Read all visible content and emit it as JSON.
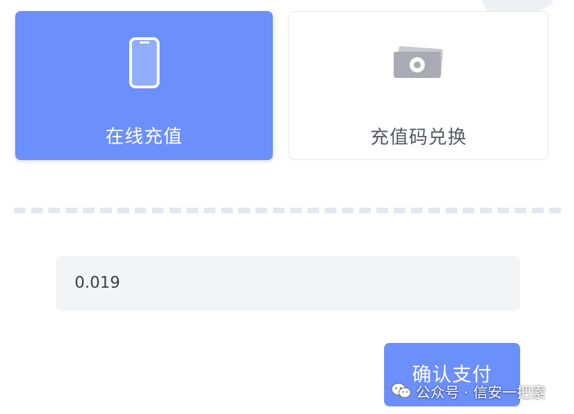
{
  "recharge_options": {
    "online": {
      "label": "在线充值",
      "icon": "phone-icon",
      "selected": true
    },
    "code": {
      "label": "充值码兑换",
      "icon": "cash-icon",
      "selected": false
    }
  },
  "amount_field": {
    "value": "0.019"
  },
  "confirm_button": {
    "label": "确认支付"
  },
  "watermark": {
    "text": "公众号 · 信安一把索",
    "icon": "wechat-icon"
  },
  "colors": {
    "accent": "#6b8ffb",
    "field_bg": "#f2f4f7",
    "divider": "#e4e8ee"
  }
}
